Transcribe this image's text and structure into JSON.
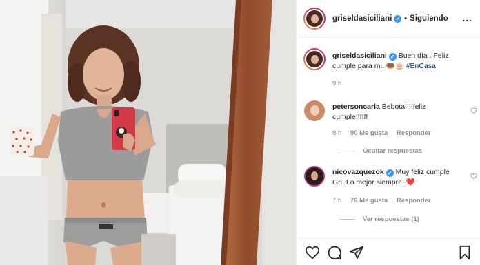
{
  "post": {
    "username": "griseldasiciliani",
    "verified_icon": "verified-badge-icon",
    "separator": "•",
    "follow_label": "Siguiendo",
    "more_label": "..."
  },
  "caption": {
    "username": "griseldasiciliani",
    "text": "Buen día . Feliz cumple para mi.",
    "emoji": "🍩🎂",
    "hashtag": "#EnCasa",
    "time": "9 h"
  },
  "comments": [
    {
      "username": "petersoncarla",
      "text": "Bebota!!!!feliz cumple!!!!!!",
      "time": "8 h",
      "likes": "90 Me gusta",
      "reply_label": "Responder",
      "thread_label": "Ocultar respuestas"
    },
    {
      "username": "nicovazquezok",
      "verified": true,
      "text": "Muy feliz cumple Gri! Lo mejor siempre!",
      "emoji": "❤️",
      "time": "7 h",
      "likes": "76 Me gusta",
      "reply_label": "Responder",
      "thread_label": "Ver respuestas (1)"
    }
  ],
  "action_icons": [
    "heart-icon",
    "comment-icon",
    "share-icon",
    "save-icon"
  ],
  "colors": {
    "verified": "#3897f0",
    "hashtag": "#00376b",
    "secondary_text": "#8e8e8e",
    "heart_red": "#ed4956"
  }
}
